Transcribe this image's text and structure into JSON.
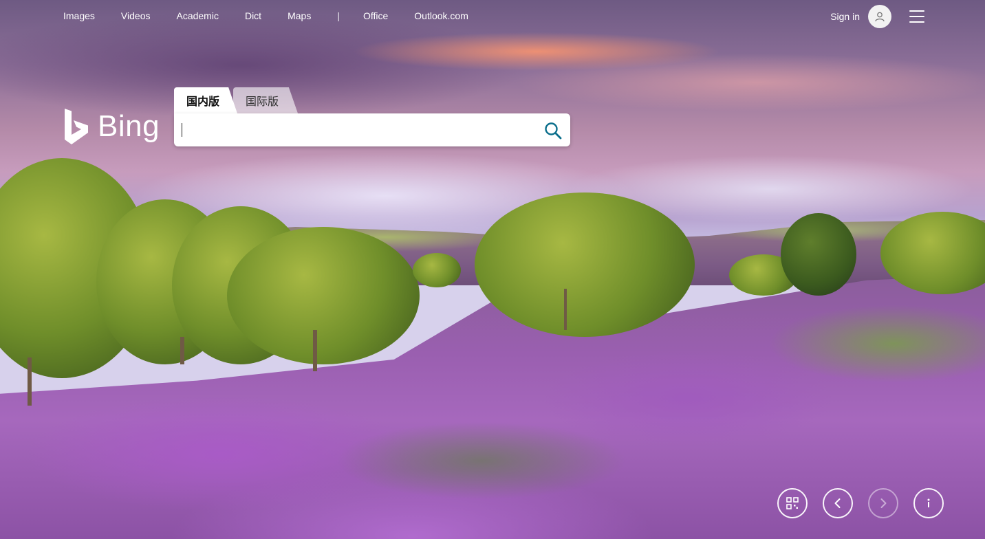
{
  "nav": {
    "links": [
      "Images",
      "Videos",
      "Academic",
      "Dict",
      "Maps"
    ],
    "separator": "|",
    "links_right": [
      "Office",
      "Outlook.com"
    ],
    "signin_label": "Sign in"
  },
  "logo": {
    "wordmark": "Bing",
    "icon": "bing-b-icon"
  },
  "search": {
    "tabs": [
      {
        "label": "国内版",
        "active": true
      },
      {
        "label": "国际版",
        "active": false
      }
    ],
    "value": "",
    "placeholder": "",
    "icon": "search-icon"
  },
  "controls": {
    "icons": [
      "qr-code-icon",
      "chevron-left-icon",
      "chevron-right-icon",
      "info-icon"
    ]
  },
  "colors": {
    "accent": "#0c8484",
    "text_light": "#ffffff"
  }
}
